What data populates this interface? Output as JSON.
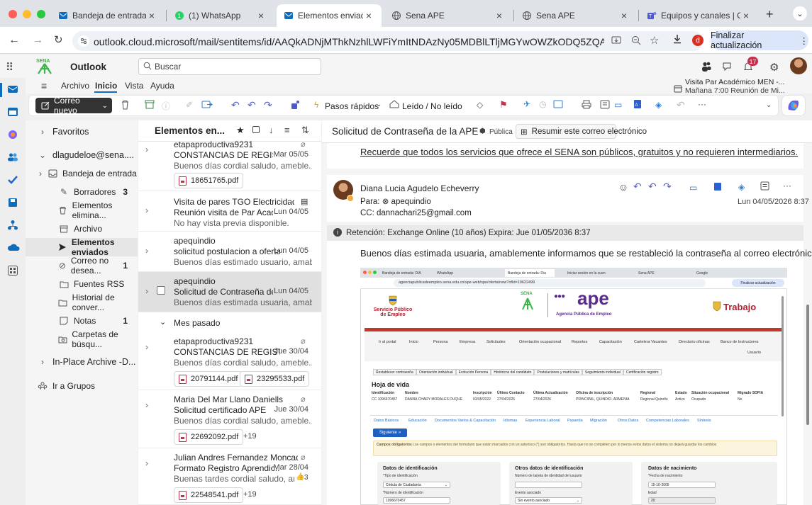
{
  "browser": {
    "tabs": [
      {
        "title": "Bandeja de entrada: DIA",
        "active": false
      },
      {
        "title": "(1) WhatsApp",
        "active": false
      },
      {
        "title": "Elementos enviados: Di",
        "active": true
      },
      {
        "title": "Sena APE",
        "active": false
      },
      {
        "title": "Sena APE",
        "active": false
      },
      {
        "title": "Equipos y canales | Gen",
        "active": false
      }
    ],
    "url": "outlook.cloud.microsoft/mail/sentitems/id/AAQkADNjMThkNzhlLWFiYmItNDAzNy05MDBlLTljMGYwOWZkODQ5ZQAQAALkwrdXvexBhJ8...",
    "update_button": "Finalizar actualización",
    "profile_letter": "d"
  },
  "outlook": {
    "app_name": "Outlook",
    "search_placeholder": "Buscar",
    "notifications_count": "17",
    "menu": [
      "Archivo",
      "Inicio",
      "Vista",
      "Ayuda"
    ],
    "active_menu": "Inicio",
    "calendar_title": "Visita Par Académico MEN -...",
    "calendar_sub": "Mañana 7:00 Reunión de Mi...",
    "new_mail": "Correo nuevo",
    "quick_steps": "Pasos rápidos",
    "read_unread": "Leído / No leído",
    "folders": {
      "favorites": "Favoritos",
      "account": "dlagudeloe@sena....",
      "items": [
        {
          "label": "Bandeja de entrada",
          "count": "",
          "icon": "inbox-icon"
        },
        {
          "label": "Borradores",
          "count": "3",
          "icon": "draft-icon"
        },
        {
          "label": "Elementos elimina...",
          "count": "",
          "icon": "trash-icon"
        },
        {
          "label": "Archivo",
          "count": "",
          "icon": "archive-icon"
        },
        {
          "label": "Elementos enviados",
          "count": "",
          "icon": "send-icon"
        },
        {
          "label": "Correo no desea...",
          "count": "1",
          "icon": "junk-icon"
        },
        {
          "label": "Fuentes RSS",
          "count": "",
          "icon": "folder-icon"
        },
        {
          "label": "Historial de conver...",
          "count": "",
          "icon": "folder-icon"
        },
        {
          "label": "Notas",
          "count": "1",
          "icon": "note-icon"
        },
        {
          "label": "Carpetas de búsqu...",
          "count": "",
          "icon": "search-folder-icon"
        }
      ],
      "archive": "In-Place Archive -D...",
      "groups": "Ir a Grupos"
    },
    "list": {
      "title": "Elementos en...",
      "group_label": "Mes pasado",
      "messages": [
        {
          "from": "etapaproductiva9231",
          "subject": "CONSTANCIAS DE REGIST...",
          "date": "Mar 05/05",
          "preview": "Buenos días cordial saludo, ameble...",
          "attachments": [
            "18651765.pdf"
          ],
          "more": ""
        },
        {
          "from": "Visita de pares TGO Electricidad I...",
          "subject": "Reunión visita de Par Acad...",
          "date": "Lun 04/05",
          "preview": "No hay vista previa disponible.",
          "attachments": [],
          "more": ""
        },
        {
          "from": "apequindio",
          "subject": "solicitud postulacion a oferta",
          "date": "Lun 04/05",
          "preview": "Buenos días estimado usuario, amable...",
          "attachments": [],
          "more": ""
        },
        {
          "from": "apequindio",
          "subject": "Solicitud de Contraseña de...",
          "date": "Lun 04/05",
          "preview": "Buenos días estimada usuaria, amable...",
          "attachments": [],
          "more": ""
        },
        {
          "from": "etapaproductiva9231",
          "subject": "CONSTANCIAS DE REGISTR...",
          "date": "Jue 30/04",
          "preview": "Buenos días cordial saludo, ameble...",
          "attachments": [
            "20791144.pdf",
            "23295533.pdf"
          ],
          "more": ""
        },
        {
          "from": "Maria Del Mar Llano Daniells",
          "subject": "Solicitud certificado APE",
          "date": "Jue 30/04",
          "preview": "Buenos días cordial saludo, ameble...",
          "attachments": [
            "22692092.pdf"
          ],
          "more": "+19"
        },
        {
          "from": "Julian Andres Fernandez Moncad...",
          "subject": "Formato Registro Aprendic...",
          "date": "Mar 28/04",
          "preview": "Buenas tardes cordial saludo, ama...",
          "attachments": [
            "22548541.pdf"
          ],
          "more": "+19",
          "reaction": "3"
        }
      ]
    },
    "reading": {
      "subject": "Solicitud de Contraseña de la APE",
      "public_label": "Pública",
      "summary_button": "Resumir este correo electrónico",
      "notice": "Recuerde que todos los servicios que ofrece el SENA son públicos, gratuitos y no requieren intermediarios.",
      "sender": "Diana Lucia Agudelo Echeverry",
      "to_label": "Para:",
      "to": "apequindio",
      "cc": "CC: dannachari25@gmail.com",
      "datetime": "Lun 04/05/2026 8:37",
      "retention": "Retención: Exchange Online (10 años) Expira: Jue 01/05/2036 8:37",
      "body": "Buenos días estimada usuaria, amablemente informamos que se restableció la contraseña al correo electrónico:"
    }
  },
  "embedded": {
    "tabs": [
      "Bandeja de entrada: DIA",
      "WhatsApp",
      "Bandeja de entrada: Dia",
      "Iniciar sesión en la cuen",
      "Sena APE",
      "Google"
    ],
    "url": "agenciapublicadeempleo.sena.edu.co/spe-web/spe/oferta/new?ofId=19622499",
    "update": "Finalizar actualización",
    "servicio": "Servicio Público de Empleo",
    "sena": "SENA",
    "ape": "ape",
    "agencia": "Agencia Pública de Empleo",
    "trabajo": "Trabajo",
    "nav": [
      "Ir al portal",
      "Inicio",
      "Persona",
      "Empresa",
      "Solicitudes",
      "Orientación ocupacional",
      "Reportes",
      "Capacitación",
      "Cartelera Vacantes",
      "Directorio oficinas",
      "Banco de Instructores"
    ],
    "user": "Usuario",
    "buttons": [
      "Restablecer contraseña",
      "Orientación individual",
      "Evolución Persona",
      "Históricos del candidato",
      "Postulaciones y matrículas",
      "Seguimiento individual",
      "Certificación registro"
    ],
    "cv_title": "Hoja de vida",
    "cv_headers": [
      "Identificación",
      "Nombre",
      "Inscripción",
      "Último Contacto",
      "Última Actualización",
      "Oficina de inscripción",
      "Regional",
      "Estado",
      "Situación ocupacional",
      "Migrado SOFIA"
    ],
    "cv_values": [
      "CC 1096670457",
      "DANNA CHARY MORALES DUQUE",
      "03/05/2022",
      "27/04/2026",
      "27/04/2026",
      "PRINCIPAL, QUINDÍO, ARMENIA",
      "Regional Quindío",
      "Activo",
      "Ocupado",
      "No"
    ],
    "subtabs": [
      "Datos Básicos",
      "Educación",
      "Documentos Varios & Capacitación",
      "Idiomas",
      "Experiencia Laboral",
      "Pasantía",
      "Migración",
      "Otros Datos",
      "Competencias Laborales",
      "Síntesis"
    ],
    "next": "Siguiente",
    "warning_bold": "Campos obligatorios",
    "warning": "Los campos o elementos del formulario que están marcados con un asterisco (*) son obligatorios. Hasta que no se completen por lo menos estos datos el sistema no dejará guardar los cambios",
    "panel1": {
      "title": "Datos de identificación",
      "l1": "*Tipo de identificación",
      "v1": "Cédula de Ciudadanía",
      "l2": "*Número de identificación",
      "v2": "1096670457"
    },
    "panel2": {
      "title": "Otros datos de identificación",
      "l1": "Número de tarjeta de identidad del usuario",
      "l2": "Evento asociado",
      "v2": "Sin evento asociado"
    },
    "panel3": {
      "title": "Datos de nacimiento",
      "l1": "*Fecha de nacimiento",
      "v1": "15-10-2005",
      "l2": "Edad",
      "v2": "20"
    }
  },
  "colors": {
    "accent": "#0f6cbd",
    "selected": "#e0e0e0",
    "red": "#c0392b",
    "green": "#3cb54a",
    "purple": "#5b2c8e"
  }
}
